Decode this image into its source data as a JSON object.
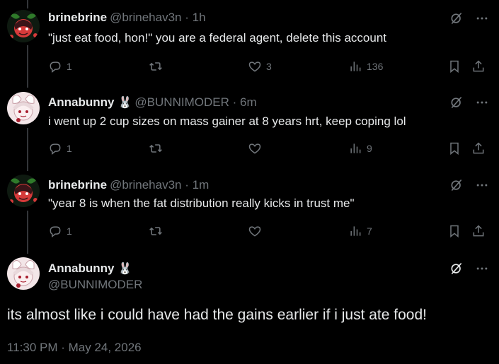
{
  "tweets": [
    {
      "name": "brinebrine",
      "handle": "@brinehav3n",
      "sep": "·",
      "time": "1h",
      "text": "\"just eat food, hon!\" you are a federal agent, delete this account",
      "replies": "1",
      "retweets": "",
      "likes": "3",
      "views": "136",
      "avatar": "demon-avatar"
    },
    {
      "name": "Annabunny",
      "badge": "🐰",
      "handle": "@BUNNIMODER",
      "sep": "·",
      "time": "6m",
      "text": "i went up 2 cup sizes on mass gainer at 8 years hrt, keep coping lol",
      "replies": "1",
      "retweets": "",
      "likes": "",
      "views": "9",
      "avatar": "bunny-avatar"
    },
    {
      "name": "brinebrine",
      "handle": "@brinehav3n",
      "sep": "·",
      "time": "1m",
      "text": "\"year 8 is when the fat distribution really kicks in trust me\"",
      "replies": "1",
      "retweets": "",
      "likes": "",
      "views": "7",
      "avatar": "demon-avatar"
    }
  ],
  "main": {
    "name": "Annabunny",
    "badge": "🐰",
    "handle": "@BUNNIMODER",
    "text": "its almost like i could have had the gains earlier if i just ate food!",
    "timestamp": "11:30 PM · May 24, 2026"
  },
  "colors": {
    "background": "#000000",
    "text": "#e7e9ea",
    "muted": "#71767b",
    "line": "#333639"
  }
}
